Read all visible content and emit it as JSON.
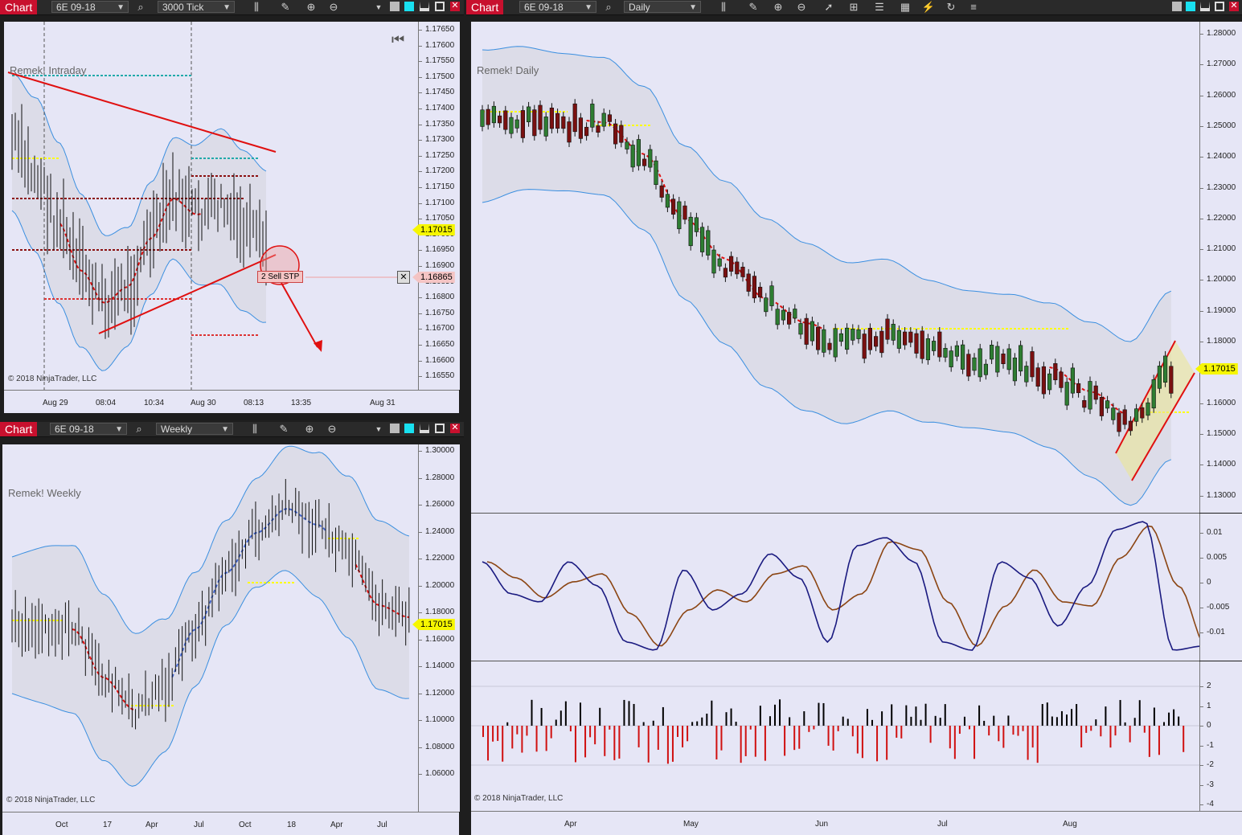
{
  "windows": {
    "intraday": {
      "chart_label": "Chart",
      "instrument": "6E 09-18",
      "period": "3000 Tick",
      "title": "Remek! Intraday",
      "copyright": "© 2018 NinjaTrader, LLC",
      "last_price": "1.17015",
      "order_price": "1.16865",
      "order_label": "2  Sell STP",
      "y_ticks": [
        "1.17650",
        "1.17600",
        "1.17550",
        "1.17500",
        "1.17450",
        "1.17400",
        "1.17350",
        "1.17300",
        "1.17250",
        "1.17200",
        "1.17150",
        "1.17100",
        "1.17050",
        "1.17000",
        "1.16950",
        "1.16900",
        "1.16850",
        "1.16800",
        "1.16750",
        "1.16700",
        "1.16650",
        "1.16600",
        "1.16550"
      ],
      "x_ticks": [
        "Aug 29",
        "08:04",
        "10:34",
        "Aug 30",
        "08:13",
        "13:35",
        "Aug 31"
      ]
    },
    "weekly": {
      "chart_label": "Chart",
      "instrument": "6E 09-18",
      "period": "Weekly",
      "title": "Remek! Weekly",
      "copyright": "© 2018 NinjaTrader, LLC",
      "last_price": "1.17015",
      "y_ticks": [
        "1.30000",
        "1.28000",
        "1.26000",
        "1.24000",
        "1.22000",
        "1.20000",
        "1.18000",
        "1.16000",
        "1.14000",
        "1.12000",
        "1.10000",
        "1.08000",
        "1.06000"
      ],
      "x_ticks": [
        "Oct",
        "17",
        "Apr",
        "Jul",
        "Oct",
        "18",
        "Apr",
        "Jul"
      ]
    },
    "daily": {
      "chart_label": "Chart",
      "instrument": "6E 09-18",
      "period": "Daily",
      "title": "Remek! Daily",
      "copyright": "© 2018 NinjaTrader, LLC",
      "last_price": "1.17015",
      "y_ticks": [
        "1.28000",
        "1.27000",
        "1.26000",
        "1.25000",
        "1.24000",
        "1.23000",
        "1.22000",
        "1.21000",
        "1.20000",
        "1.19000",
        "1.18000",
        "1.17000",
        "1.16000",
        "1.15000",
        "1.14000",
        "1.13000"
      ],
      "osc_ticks": [
        "0.01",
        "0.005",
        "0",
        "-0.005",
        "-0.01"
      ],
      "hist_ticks": [
        "2",
        "1",
        "0",
        "-1",
        "-2",
        "-3",
        "-4"
      ],
      "x_ticks": [
        "Apr",
        "May",
        "Jun",
        "Jul",
        "Aug"
      ]
    }
  },
  "colors": {
    "background": "#e6e6f6",
    "band": "#dcdce8",
    "band_line": "#3b8fe0",
    "up_candle": "#2e7d32",
    "down_candle": "#7a1010",
    "trendline": "#e01010",
    "yellow_level": "#ffff00",
    "osc_fast": "#1a1a80",
    "osc_slow": "#8b4513",
    "hist_neg": "#d01010",
    "hist_pos": "#000000"
  },
  "toolbar_icons": [
    "search-icon",
    "bar-type-icon",
    "pencil-icon",
    "zoom-in-icon",
    "zoom-out-icon",
    "cursor-icon",
    "data-box-icon",
    "properties-icon",
    "strategy-icon",
    "indicator-icon",
    "refresh-icon",
    "list-icon"
  ]
}
